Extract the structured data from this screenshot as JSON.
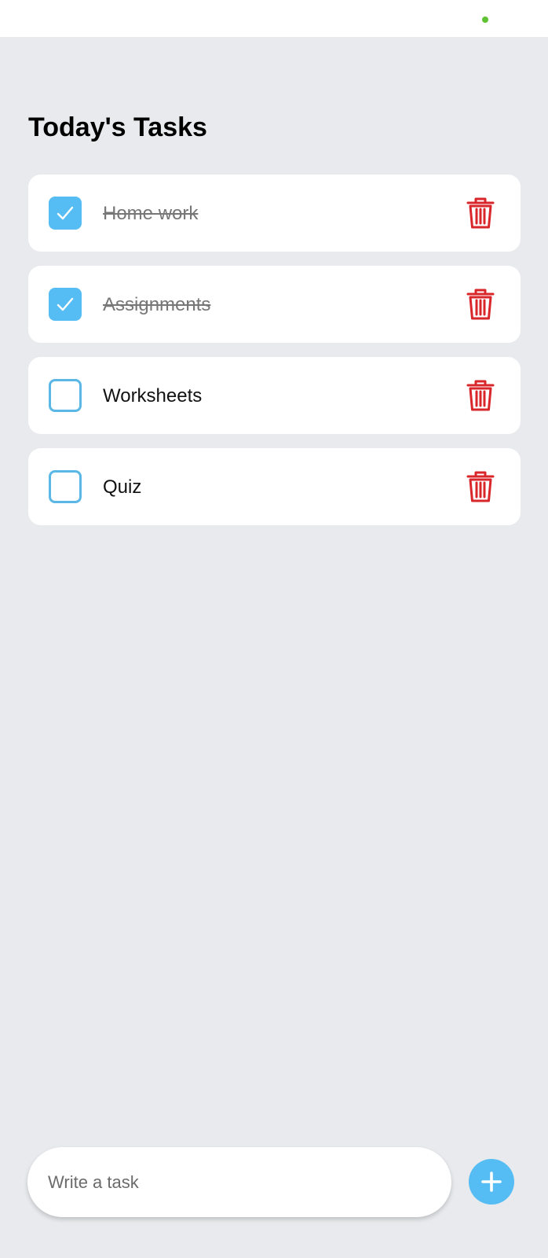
{
  "colors": {
    "background": "#e8eaed",
    "card": "#ffffff",
    "accent": "#5bb8e6",
    "checkbox_fill": "#55bdf3",
    "delete": "#d9262b",
    "status_dot": "#5ec232",
    "title": "#000000",
    "done_text": "#777777"
  },
  "header": {
    "title": "Today's Tasks"
  },
  "tasks": [
    {
      "label": "Home work",
      "done": true,
      "delete_icon": "trash-icon"
    },
    {
      "label": "Assignments",
      "done": true,
      "delete_icon": "trash-icon"
    },
    {
      "label": "Worksheets",
      "done": false,
      "delete_icon": "trash-icon"
    },
    {
      "label": "Quiz",
      "done": false,
      "delete_icon": "trash-icon"
    }
  ],
  "composer": {
    "placeholder": "Write a task",
    "value": "",
    "add_icon": "plus-icon"
  }
}
